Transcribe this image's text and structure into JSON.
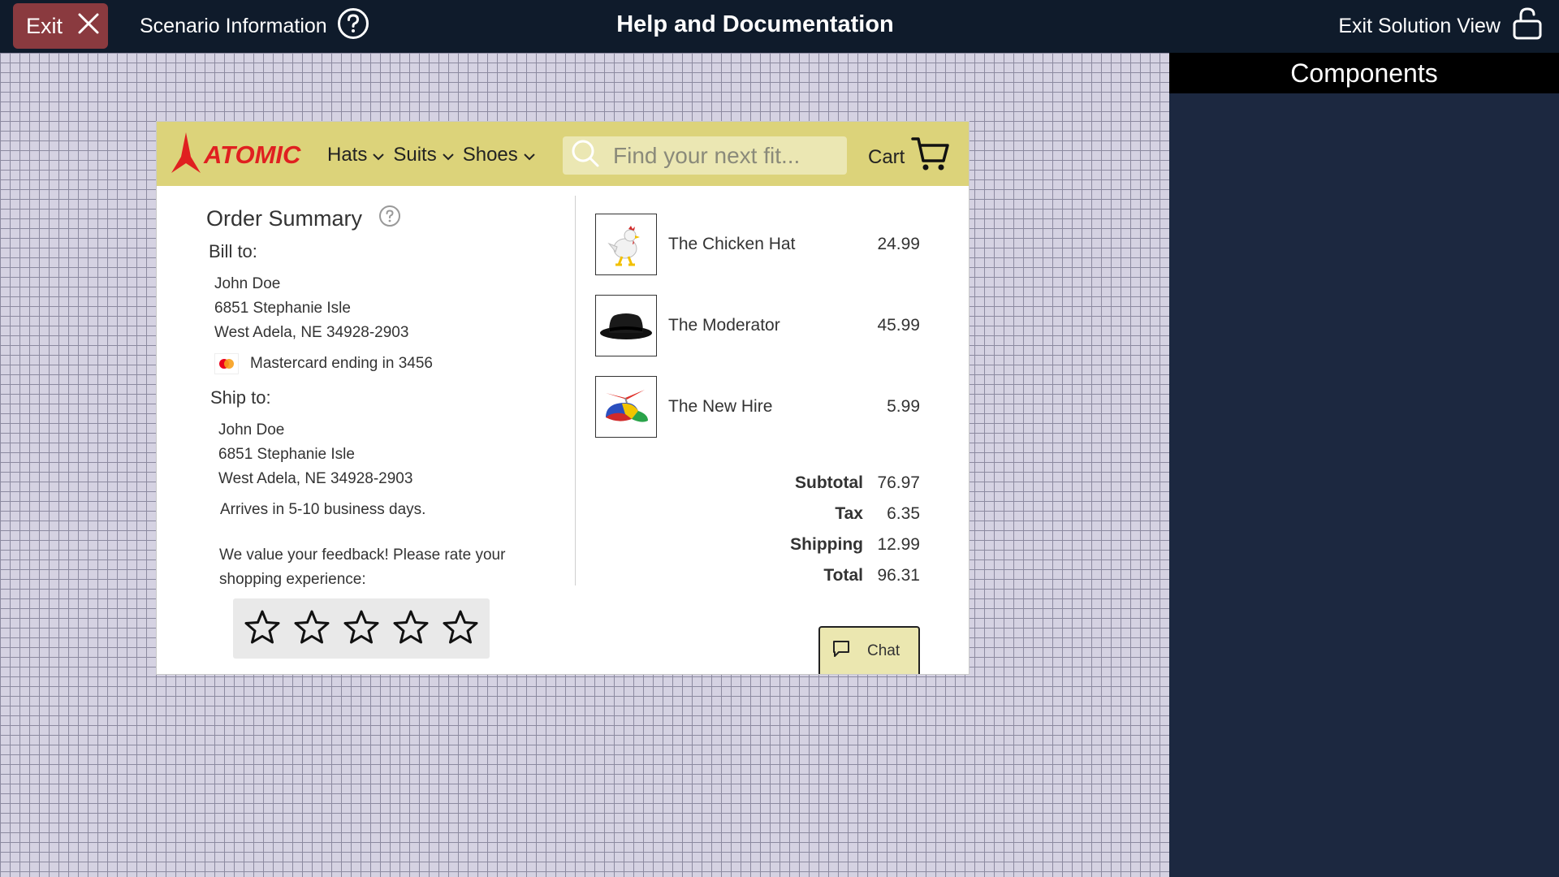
{
  "topbar": {
    "exit_label": "Exit",
    "scenario_label": "Scenario Information",
    "title": "Help and Documentation",
    "exit_solution_label": "Exit Solution View"
  },
  "components": {
    "title": "Components"
  },
  "store": {
    "logo_text": "ATOMIC",
    "nav": [
      "Hats",
      "Suits",
      "Shoes"
    ],
    "search_placeholder": "Find your next fit...",
    "cart_label": "Cart",
    "brand_color": "#e02020",
    "nav_color": "#dcd37a"
  },
  "summary": {
    "title": "Order Summary",
    "bill_to_label": "Bill to:",
    "bill": {
      "name": "John Doe",
      "street": "6851 Stephanie Isle",
      "city": "West Adela, NE 34928-2903"
    },
    "card_text": "Mastercard ending in 3456",
    "ship_to_label": "Ship to:",
    "ship": {
      "name": "John Doe",
      "street": "6851 Stephanie Isle",
      "city": "West Adela, NE 34928-2903"
    },
    "arrives": "Arrives in 5-10 business days.",
    "feedback": "We value your feedback! Please rate your shopping experience:",
    "rating": 0,
    "rating_max": 5
  },
  "items": [
    {
      "name": "The Chicken Hat",
      "price": "24.99",
      "icon": "chicken-hat-image"
    },
    {
      "name": "The Moderator",
      "price": "45.99",
      "icon": "fedora-hat-image"
    },
    {
      "name": "The New Hire",
      "price": "5.99",
      "icon": "propeller-cap-image"
    }
  ],
  "totals": {
    "subtotal_label": "Subtotal",
    "subtotal": "76.97",
    "tax_label": "Tax",
    "tax": "6.35",
    "shipping_label": "Shipping",
    "shipping": "12.99",
    "total_label": "Total",
    "total": "96.31"
  },
  "chat_label": "Chat"
}
